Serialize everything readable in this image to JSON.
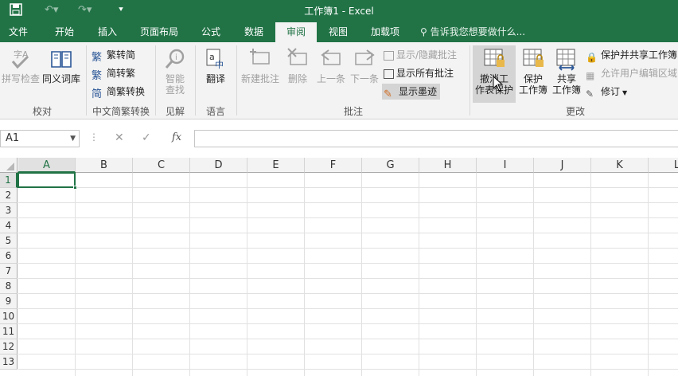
{
  "titlebar": {
    "title": "工作簿1 - Excel"
  },
  "tabs": [
    {
      "label": "文件"
    },
    {
      "label": "开始"
    },
    {
      "label": "插入"
    },
    {
      "label": "页面布局"
    },
    {
      "label": "公式"
    },
    {
      "label": "数据"
    },
    {
      "label": "审阅"
    },
    {
      "label": "视图"
    },
    {
      "label": "加载项"
    }
  ],
  "tellme": "告诉我您想要做什么...",
  "ribbon": {
    "proofing": {
      "spell": "拼写检查",
      "thesaurus": "同义词库",
      "label": "校对"
    },
    "chinese": {
      "t2s": "繁转简",
      "s2t": "简转繁",
      "convert": "简繁转换",
      "label": "中文简繁转换"
    },
    "insights": {
      "smart_line1": "智能",
      "smart_line2": "查找",
      "label": "见解"
    },
    "language": {
      "translate": "翻译",
      "label": "语言"
    },
    "comments": {
      "new": "新建批注",
      "delete": "删除",
      "prev": "上一条",
      "next": "下一条",
      "show_hide": "显示/隐藏批注",
      "show_all": "显示所有批注",
      "show_ink": "显示墨迹",
      "label": "批注"
    },
    "changes": {
      "unprotect_l1": "撤消工",
      "unprotect_l2": "作表保护",
      "protect_l1": "保护",
      "protect_l2": "工作簿",
      "share_l1": "共享",
      "share_l2": "工作簿",
      "protect_share": "保护并共享工作簿",
      "allow_edit": "允许用户编辑区域",
      "track": "修订",
      "label": "更改"
    }
  },
  "formulabar": {
    "namebox": "A1",
    "fx": "fx",
    "value": ""
  },
  "grid": {
    "columns": [
      "A",
      "B",
      "C",
      "D",
      "E",
      "F",
      "G",
      "H",
      "I",
      "J",
      "K",
      "L"
    ],
    "rows": [
      "1",
      "2",
      "3",
      "4",
      "5",
      "6",
      "7",
      "8",
      "9",
      "10",
      "11",
      "12",
      "13"
    ],
    "selected": "A1"
  },
  "colors": {
    "accent": "#217346",
    "ribbon_bg": "#f3f3f3",
    "disabled": "#a0a0a0"
  }
}
